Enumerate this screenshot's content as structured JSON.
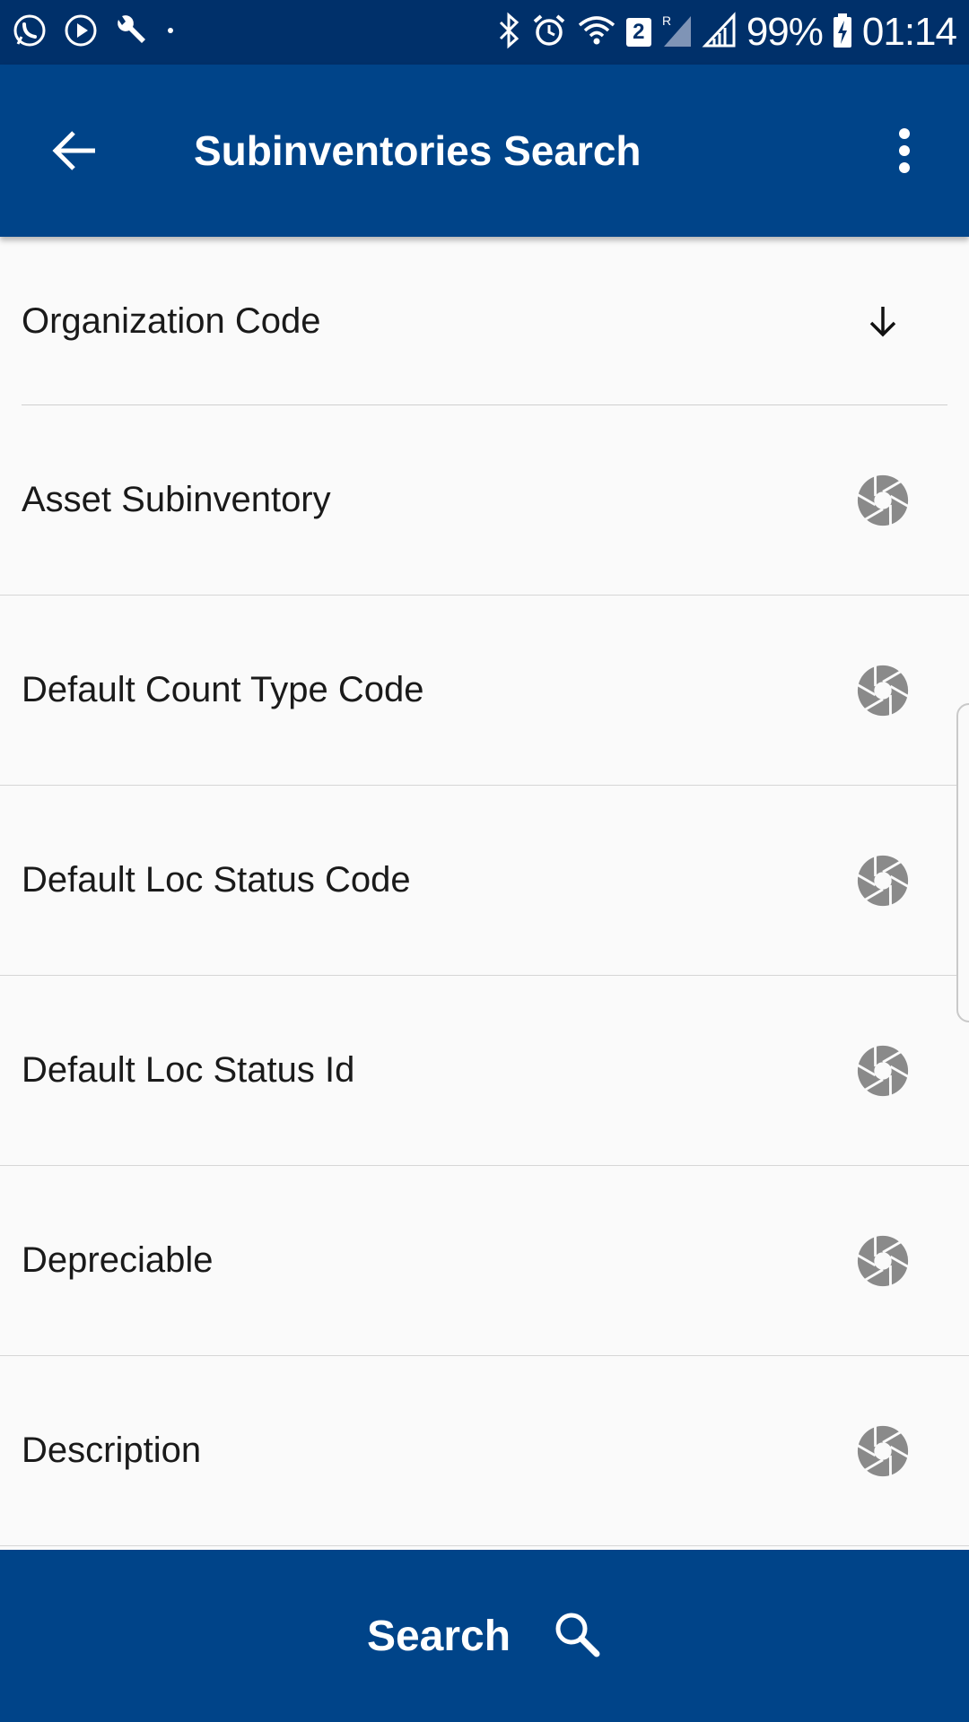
{
  "status_bar": {
    "notification_icons": [
      "whatsapp-icon",
      "play-icon",
      "wrench-icon",
      "dot-icon"
    ],
    "system_icons": [
      "bluetooth-icon",
      "alarm-icon",
      "wifi-icon",
      "sim-badge",
      "signal-r-icon",
      "signal-icon"
    ],
    "sim_number": "2",
    "battery": "99%",
    "time": "01:14"
  },
  "app_bar": {
    "title": "Subinventories Search",
    "back_icon": "arrow-back-icon",
    "menu_icon": "more-vert-icon"
  },
  "fields": [
    {
      "label": "Organization Code",
      "icon": "arrow-down-icon"
    },
    {
      "label": "Asset Subinventory",
      "icon": "aperture-icon"
    },
    {
      "label": "Default Count Type Code",
      "icon": "aperture-icon"
    },
    {
      "label": "Default Loc Status Code",
      "icon": "aperture-icon"
    },
    {
      "label": "Default Loc Status Id",
      "icon": "aperture-icon"
    },
    {
      "label": "Depreciable",
      "icon": "aperture-icon"
    },
    {
      "label": "Description",
      "icon": "aperture-icon"
    }
  ],
  "search_button": {
    "label": "Search",
    "icon": "search-icon"
  },
  "colors": {
    "status_bar": "#00306a",
    "primary": "#004489",
    "background": "#fafafa",
    "icon_gray": "#8a8a8a"
  }
}
